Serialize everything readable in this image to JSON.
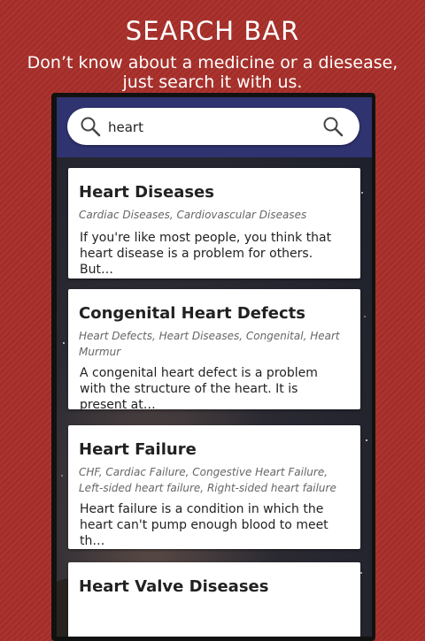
{
  "promo": {
    "title": "SEARCH BAR",
    "subtitle": "Don’t know about a medicine or a diesease, just search it with us."
  },
  "search": {
    "value": "heart"
  },
  "results": [
    {
      "title": "Heart Diseases",
      "tags": "Cardiac Diseases, Cardiovascular Diseases",
      "description": "If you're like most people, you think that heart disease is a problem for others. But…"
    },
    {
      "title": "Congenital Heart Defects",
      "tags": "Heart Defects, Heart Diseases, Congenital, Heart Murmur",
      "description": "A congenital heart defect is a problem with the structure of the heart. It is present at…"
    },
    {
      "title": "Heart Failure",
      "tags": "CHF, Cardiac Failure, Congestive Heart Failure, Left-sided heart failure, Right-sided heart failure",
      "description": "Heart failure is a condition in which the heart can't pump enough blood to meet th…"
    },
    {
      "title": "Heart Valve Diseases"
    }
  ],
  "colors": {
    "background": "#a8302a",
    "toolbar": "#2f3370",
    "card": "#ffffff"
  }
}
